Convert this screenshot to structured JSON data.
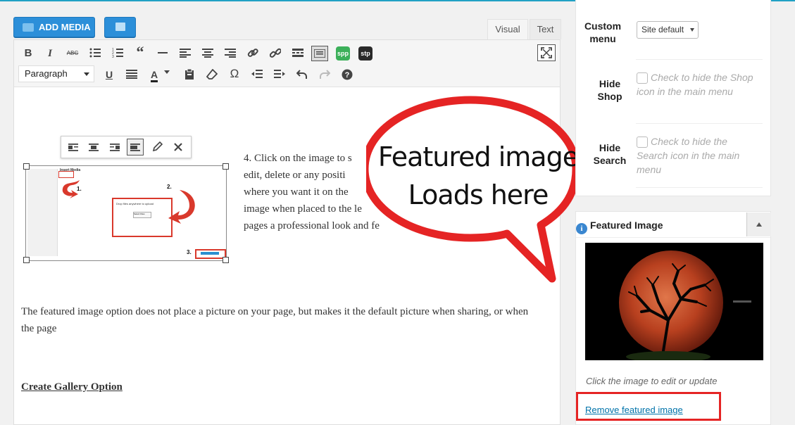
{
  "media": {
    "add_media_label": "ADD MEDIA"
  },
  "tabs": {
    "visual": "Visual",
    "text": "Text"
  },
  "toolbar": {
    "format_value": "Paragraph",
    "spp_label": "spp",
    "stp_label": "stp",
    "buttons": [
      "bold-icon",
      "italic-icon",
      "strikethrough-icon",
      "bulleted-list-icon",
      "numbered-list-icon",
      "blockquote-icon",
      "horizontal-line-icon",
      "align-left-icon",
      "align-center-icon",
      "align-right-icon",
      "insert-link-icon",
      "remove-link-icon",
      "read-more-icon",
      "toolbar-toggle-icon",
      "fullscreen-icon",
      "underline-icon",
      "justify-icon",
      "text-color-icon",
      "paste-text-icon",
      "clear-formatting-icon",
      "special-character-icon",
      "outdent-icon",
      "indent-icon",
      "undo-icon",
      "redo-icon",
      "help-icon"
    ]
  },
  "content": {
    "step4_lines": [
      "4. Click on the image to s",
      "edit, delete or any positi",
      "where you want it on the",
      "image when placed to the le",
      "pages a professional look and fe"
    ],
    "featured_paragraph": "The featured image option does not place a picture on your page, but makes it the default picture when sharing, or when the page",
    "gallery_heading": "Create Gallery Option",
    "inline_image": {
      "title": "Insert Media",
      "upload_text": "Drop files anywhere to upload",
      "upload_button": "Select Files",
      "numbers": [
        "1.",
        "2.",
        "3."
      ]
    }
  },
  "callout": {
    "line1": "Featured image",
    "line2": "Loads here"
  },
  "sidebar": {
    "custom_menu_label": "Custom menu",
    "custom_menu_value": "Site default",
    "hide_shop_label": "Hide Shop",
    "hide_shop_text": "Check to hide the Shop icon in the main menu",
    "hide_search_label": "Hide Search",
    "hide_search_text": "Check to hide the Search icon in the main menu"
  },
  "featured_image": {
    "title": "Featured Image",
    "hint": "Click the image to edit or update",
    "remove_link": "Remove featured image"
  },
  "colors": {
    "accent": "#2c8fd9",
    "highlight": "#e52424",
    "link": "#0073aa"
  }
}
